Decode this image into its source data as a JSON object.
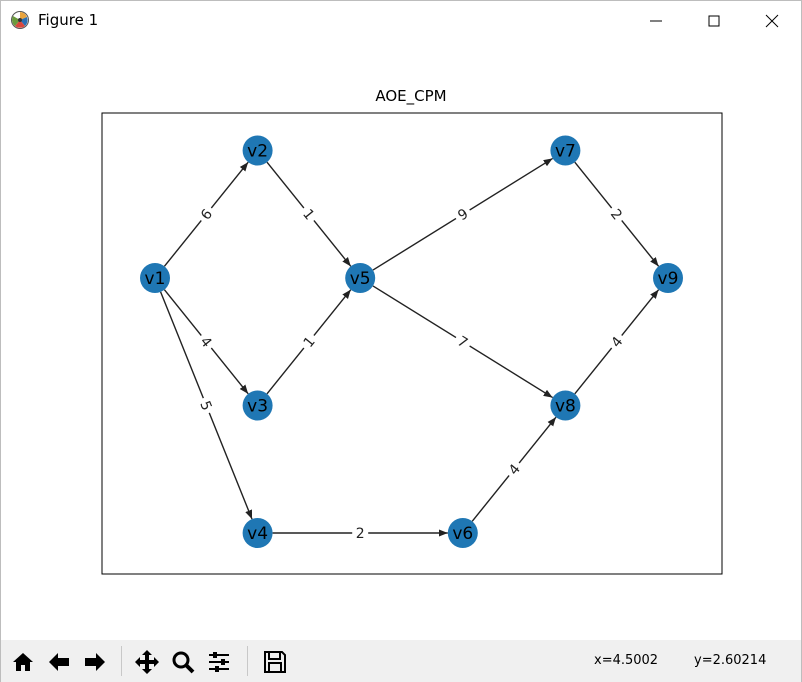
{
  "window": {
    "title": "Figure 1",
    "icons": [
      "matplotlib-icon",
      "minimize-icon",
      "maximize-icon",
      "close-icon"
    ]
  },
  "diagram": {
    "title": "AOE_CPM",
    "node_color": "#1f77b4",
    "edge_color": "#222222",
    "nodes": [
      {
        "id": "v1",
        "x": 0,
        "y": 0
      },
      {
        "id": "v2",
        "x": 1,
        "y": 1
      },
      {
        "id": "v3",
        "x": 1,
        "y": -1
      },
      {
        "id": "v4",
        "x": 1,
        "y": -2
      },
      {
        "id": "v5",
        "x": 2,
        "y": 0
      },
      {
        "id": "v6",
        "x": 3,
        "y": -2
      },
      {
        "id": "v7",
        "x": 4,
        "y": 1
      },
      {
        "id": "v8",
        "x": 4,
        "y": -1
      },
      {
        "id": "v9",
        "x": 5,
        "y": 0
      }
    ],
    "edges": [
      {
        "from": "v1",
        "to": "v2",
        "weight": "6"
      },
      {
        "from": "v1",
        "to": "v3",
        "weight": "4"
      },
      {
        "from": "v1",
        "to": "v4",
        "weight": "5"
      },
      {
        "from": "v2",
        "to": "v5",
        "weight": "1"
      },
      {
        "from": "v3",
        "to": "v5",
        "weight": "1"
      },
      {
        "from": "v4",
        "to": "v6",
        "weight": "2"
      },
      {
        "from": "v5",
        "to": "v7",
        "weight": "9"
      },
      {
        "from": "v5",
        "to": "v8",
        "weight": "7"
      },
      {
        "from": "v6",
        "to": "v8",
        "weight": "4"
      },
      {
        "from": "v7",
        "to": "v9",
        "weight": "2"
      },
      {
        "from": "v8",
        "to": "v9",
        "weight": "4"
      }
    ]
  },
  "toolbar": {
    "tools": [
      "home-icon",
      "back-icon",
      "forward-icon",
      "pan-icon",
      "zoom-icon",
      "configure-subplots-icon",
      "save-icon"
    ],
    "x_readout": "x=4.5002",
    "y_readout": "y=2.60214"
  }
}
